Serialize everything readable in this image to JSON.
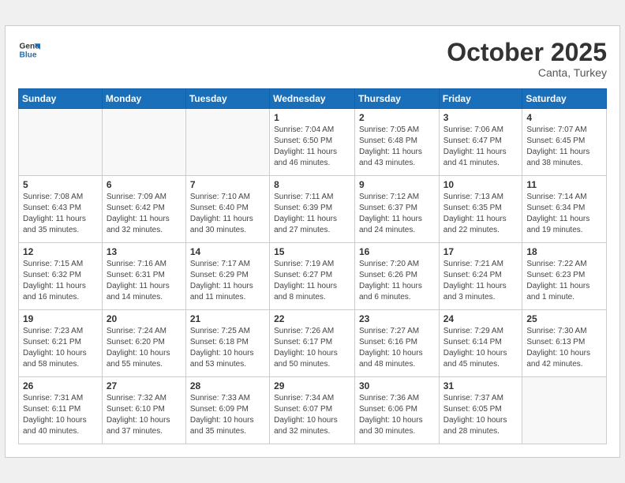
{
  "header": {
    "logo_line1": "General",
    "logo_line2": "Blue",
    "month": "October 2025",
    "location": "Canta, Turkey"
  },
  "weekdays": [
    "Sunday",
    "Monday",
    "Tuesday",
    "Wednesday",
    "Thursday",
    "Friday",
    "Saturday"
  ],
  "weeks": [
    [
      {
        "day": "",
        "info": ""
      },
      {
        "day": "",
        "info": ""
      },
      {
        "day": "",
        "info": ""
      },
      {
        "day": "1",
        "info": "Sunrise: 7:04 AM\nSunset: 6:50 PM\nDaylight: 11 hours\nand 46 minutes."
      },
      {
        "day": "2",
        "info": "Sunrise: 7:05 AM\nSunset: 6:48 PM\nDaylight: 11 hours\nand 43 minutes."
      },
      {
        "day": "3",
        "info": "Sunrise: 7:06 AM\nSunset: 6:47 PM\nDaylight: 11 hours\nand 41 minutes."
      },
      {
        "day": "4",
        "info": "Sunrise: 7:07 AM\nSunset: 6:45 PM\nDaylight: 11 hours\nand 38 minutes."
      }
    ],
    [
      {
        "day": "5",
        "info": "Sunrise: 7:08 AM\nSunset: 6:43 PM\nDaylight: 11 hours\nand 35 minutes."
      },
      {
        "day": "6",
        "info": "Sunrise: 7:09 AM\nSunset: 6:42 PM\nDaylight: 11 hours\nand 32 minutes."
      },
      {
        "day": "7",
        "info": "Sunrise: 7:10 AM\nSunset: 6:40 PM\nDaylight: 11 hours\nand 30 minutes."
      },
      {
        "day": "8",
        "info": "Sunrise: 7:11 AM\nSunset: 6:39 PM\nDaylight: 11 hours\nand 27 minutes."
      },
      {
        "day": "9",
        "info": "Sunrise: 7:12 AM\nSunset: 6:37 PM\nDaylight: 11 hours\nand 24 minutes."
      },
      {
        "day": "10",
        "info": "Sunrise: 7:13 AM\nSunset: 6:35 PM\nDaylight: 11 hours\nand 22 minutes."
      },
      {
        "day": "11",
        "info": "Sunrise: 7:14 AM\nSunset: 6:34 PM\nDaylight: 11 hours\nand 19 minutes."
      }
    ],
    [
      {
        "day": "12",
        "info": "Sunrise: 7:15 AM\nSunset: 6:32 PM\nDaylight: 11 hours\nand 16 minutes."
      },
      {
        "day": "13",
        "info": "Sunrise: 7:16 AM\nSunset: 6:31 PM\nDaylight: 11 hours\nand 14 minutes."
      },
      {
        "day": "14",
        "info": "Sunrise: 7:17 AM\nSunset: 6:29 PM\nDaylight: 11 hours\nand 11 minutes."
      },
      {
        "day": "15",
        "info": "Sunrise: 7:19 AM\nSunset: 6:27 PM\nDaylight: 11 hours\nand 8 minutes."
      },
      {
        "day": "16",
        "info": "Sunrise: 7:20 AM\nSunset: 6:26 PM\nDaylight: 11 hours\nand 6 minutes."
      },
      {
        "day": "17",
        "info": "Sunrise: 7:21 AM\nSunset: 6:24 PM\nDaylight: 11 hours\nand 3 minutes."
      },
      {
        "day": "18",
        "info": "Sunrise: 7:22 AM\nSunset: 6:23 PM\nDaylight: 11 hours\nand 1 minute."
      }
    ],
    [
      {
        "day": "19",
        "info": "Sunrise: 7:23 AM\nSunset: 6:21 PM\nDaylight: 10 hours\nand 58 minutes."
      },
      {
        "day": "20",
        "info": "Sunrise: 7:24 AM\nSunset: 6:20 PM\nDaylight: 10 hours\nand 55 minutes."
      },
      {
        "day": "21",
        "info": "Sunrise: 7:25 AM\nSunset: 6:18 PM\nDaylight: 10 hours\nand 53 minutes."
      },
      {
        "day": "22",
        "info": "Sunrise: 7:26 AM\nSunset: 6:17 PM\nDaylight: 10 hours\nand 50 minutes."
      },
      {
        "day": "23",
        "info": "Sunrise: 7:27 AM\nSunset: 6:16 PM\nDaylight: 10 hours\nand 48 minutes."
      },
      {
        "day": "24",
        "info": "Sunrise: 7:29 AM\nSunset: 6:14 PM\nDaylight: 10 hours\nand 45 minutes."
      },
      {
        "day": "25",
        "info": "Sunrise: 7:30 AM\nSunset: 6:13 PM\nDaylight: 10 hours\nand 42 minutes."
      }
    ],
    [
      {
        "day": "26",
        "info": "Sunrise: 7:31 AM\nSunset: 6:11 PM\nDaylight: 10 hours\nand 40 minutes."
      },
      {
        "day": "27",
        "info": "Sunrise: 7:32 AM\nSunset: 6:10 PM\nDaylight: 10 hours\nand 37 minutes."
      },
      {
        "day": "28",
        "info": "Sunrise: 7:33 AM\nSunset: 6:09 PM\nDaylight: 10 hours\nand 35 minutes."
      },
      {
        "day": "29",
        "info": "Sunrise: 7:34 AM\nSunset: 6:07 PM\nDaylight: 10 hours\nand 32 minutes."
      },
      {
        "day": "30",
        "info": "Sunrise: 7:36 AM\nSunset: 6:06 PM\nDaylight: 10 hours\nand 30 minutes."
      },
      {
        "day": "31",
        "info": "Sunrise: 7:37 AM\nSunset: 6:05 PM\nDaylight: 10 hours\nand 28 minutes."
      },
      {
        "day": "",
        "info": ""
      }
    ]
  ]
}
